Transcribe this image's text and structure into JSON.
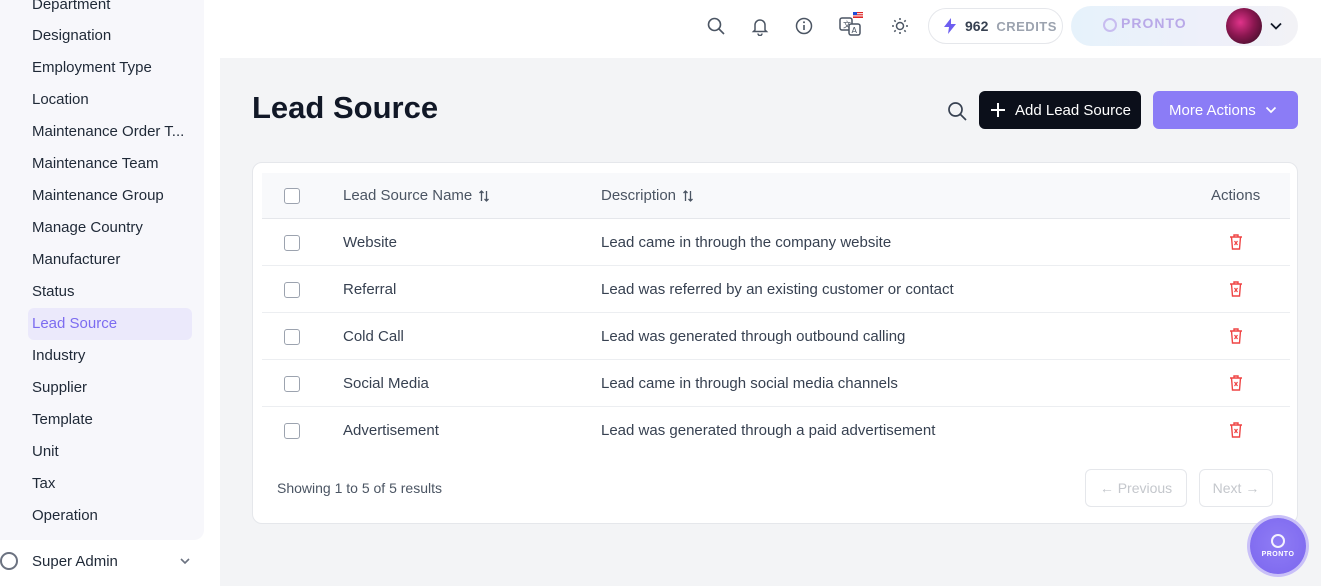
{
  "sidebar": {
    "items": [
      {
        "label": "Department"
      },
      {
        "label": "Designation"
      },
      {
        "label": "Employment Type"
      },
      {
        "label": "Location"
      },
      {
        "label": "Maintenance Order T..."
      },
      {
        "label": "Maintenance Team"
      },
      {
        "label": "Maintenance Group"
      },
      {
        "label": "Manage Country"
      },
      {
        "label": "Manufacturer"
      },
      {
        "label": "Status"
      },
      {
        "label": "Lead Source"
      },
      {
        "label": "Industry"
      },
      {
        "label": "Supplier"
      },
      {
        "label": "Template"
      },
      {
        "label": "Unit"
      },
      {
        "label": "Tax"
      },
      {
        "label": "Operation"
      }
    ],
    "active_item": "Lead Source",
    "footer_label": "Super Admin"
  },
  "topbar": {
    "icons": [
      "search-icon",
      "bell-icon",
      "info-icon",
      "translate-icon",
      "sun-icon"
    ],
    "credits_value": "962",
    "credits_label": "CREDITS",
    "brand": "PRONTO"
  },
  "page": {
    "title": "Lead Source",
    "add_button": "Add Lead Source",
    "more_button": "More Actions"
  },
  "table": {
    "columns": {
      "name": "Lead Source Name",
      "description": "Description",
      "actions": "Actions"
    },
    "rows": [
      {
        "name": "Website",
        "description": "Lead came in through the company website"
      },
      {
        "name": "Referral",
        "description": "Lead was referred by an existing customer or contact"
      },
      {
        "name": "Cold Call",
        "description": "Lead was generated through outbound calling"
      },
      {
        "name": "Social Media",
        "description": "Lead came in through social media channels"
      },
      {
        "name": "Advertisement",
        "description": "Lead was generated through a paid advertisement"
      }
    ],
    "summary": "Showing 1 to 5 of 5 results",
    "previous": "← Previous",
    "next": "Next →"
  },
  "fab": {
    "label": "PRONTO"
  },
  "colors": {
    "accent": "#8b7cf6",
    "primary_button": "#0b0f1a",
    "delete": "#ef4444",
    "active_nav_text": "#7c6cf0"
  }
}
